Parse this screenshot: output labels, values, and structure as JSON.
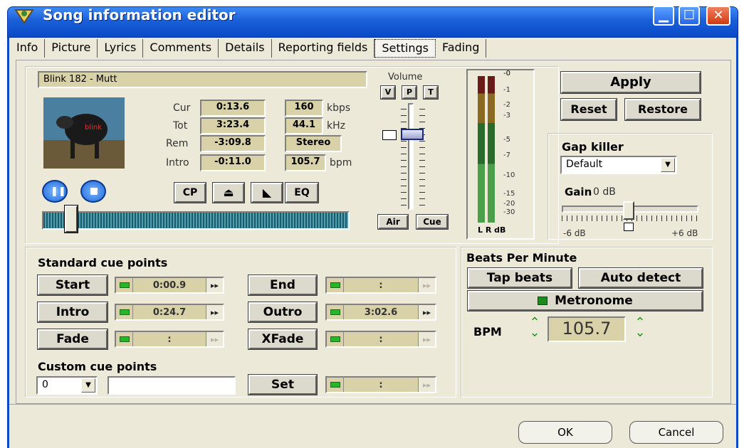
{
  "window": {
    "title": "Song information editor",
    "min_icon": "minimize-icon",
    "max_icon": "maximize-icon",
    "close_icon": "close-icon"
  },
  "tabs": [
    "Info",
    "Picture",
    "Lyrics",
    "Comments",
    "Details",
    "Reporting fields",
    "Settings",
    "Fading"
  ],
  "active_tab": "Settings",
  "player": {
    "song": "Blink 182 - Mutt",
    "cur_label": "Cur",
    "cur": "0:13.6",
    "tot_label": "Tot",
    "tot": "3:23.4",
    "rem_label": "Rem",
    "rem": "-3:09.8",
    "intro_label": "Intro",
    "intro": "-0:11.0",
    "bitrate": "160",
    "bitrate_unit": "kbps",
    "samplerate": "44.1",
    "samplerate_unit": "kHz",
    "channels": "Stereo",
    "bpm": "105.7",
    "bpm_unit": "bpm",
    "buttons": [
      "CP",
      "⏏",
      "◣",
      "EQ"
    ],
    "volume_label": "Volume",
    "vpt": [
      "V",
      "P",
      "T"
    ],
    "air": "Air",
    "cue": "Cue",
    "meter_scale": [
      "-0",
      "-1",
      "-2",
      "-3",
      "-5",
      "-7",
      "-10",
      "-15",
      "-20",
      "-30"
    ],
    "meter_labels": "L R dB"
  },
  "actions": {
    "apply": "Apply",
    "reset": "Reset",
    "restore": "Restore"
  },
  "gap_killer": {
    "title": "Gap killer",
    "select": "Default",
    "gain_label": "Gain",
    "gain_value": "0 dB",
    "min": "-6 dB",
    "max": "+6 dB"
  },
  "standard_cue": {
    "title": "Standard cue points",
    "rows": [
      {
        "label": "Start",
        "value": "0:00.9"
      },
      {
        "label": "Intro",
        "value": "0:24.7"
      },
      {
        "label": "Fade",
        "value": ":"
      },
      {
        "label": "End",
        "value": ":"
      },
      {
        "label": "Outro",
        "value": "3:02.6"
      },
      {
        "label": "XFade",
        "value": ":"
      }
    ]
  },
  "custom_cue": {
    "title": "Custom cue points",
    "select": "0",
    "input": "",
    "set": "Set",
    "value": ":"
  },
  "bpm_panel": {
    "title": "Beats Per Minute",
    "tap": "Tap beats",
    "auto": "Auto detect",
    "metronome": "Metronome",
    "bpm_label": "BPM",
    "bpm_value": "105.7"
  },
  "footer": {
    "ok": "OK",
    "cancel": "Cancel"
  }
}
